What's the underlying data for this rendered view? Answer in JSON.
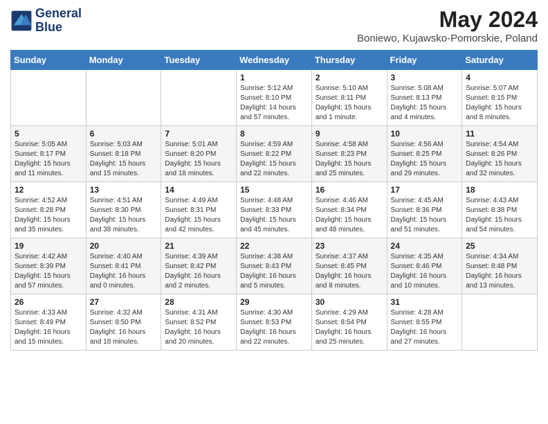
{
  "logo": {
    "line1": "General",
    "line2": "Blue"
  },
  "title": "May 2024",
  "subtitle": "Boniewo, Kujawsko-Pomorskie, Poland",
  "headers": [
    "Sunday",
    "Monday",
    "Tuesday",
    "Wednesday",
    "Thursday",
    "Friday",
    "Saturday"
  ],
  "weeks": [
    [
      {
        "day": "",
        "info": ""
      },
      {
        "day": "",
        "info": ""
      },
      {
        "day": "",
        "info": ""
      },
      {
        "day": "1",
        "info": "Sunrise: 5:12 AM\nSunset: 8:10 PM\nDaylight: 14 hours\nand 57 minutes."
      },
      {
        "day": "2",
        "info": "Sunrise: 5:10 AM\nSunset: 8:11 PM\nDaylight: 15 hours\nand 1 minute."
      },
      {
        "day": "3",
        "info": "Sunrise: 5:08 AM\nSunset: 8:13 PM\nDaylight: 15 hours\nand 4 minutes."
      },
      {
        "day": "4",
        "info": "Sunrise: 5:07 AM\nSunset: 8:15 PM\nDaylight: 15 hours\nand 8 minutes."
      }
    ],
    [
      {
        "day": "5",
        "info": "Sunrise: 5:05 AM\nSunset: 8:17 PM\nDaylight: 15 hours\nand 11 minutes."
      },
      {
        "day": "6",
        "info": "Sunrise: 5:03 AM\nSunset: 8:18 PM\nDaylight: 15 hours\nand 15 minutes."
      },
      {
        "day": "7",
        "info": "Sunrise: 5:01 AM\nSunset: 8:20 PM\nDaylight: 15 hours\nand 18 minutes."
      },
      {
        "day": "8",
        "info": "Sunrise: 4:59 AM\nSunset: 8:22 PM\nDaylight: 15 hours\nand 22 minutes."
      },
      {
        "day": "9",
        "info": "Sunrise: 4:58 AM\nSunset: 8:23 PM\nDaylight: 15 hours\nand 25 minutes."
      },
      {
        "day": "10",
        "info": "Sunrise: 4:56 AM\nSunset: 8:25 PM\nDaylight: 15 hours\nand 29 minutes."
      },
      {
        "day": "11",
        "info": "Sunrise: 4:54 AM\nSunset: 8:26 PM\nDaylight: 15 hours\nand 32 minutes."
      }
    ],
    [
      {
        "day": "12",
        "info": "Sunrise: 4:52 AM\nSunset: 8:28 PM\nDaylight: 15 hours\nand 35 minutes."
      },
      {
        "day": "13",
        "info": "Sunrise: 4:51 AM\nSunset: 8:30 PM\nDaylight: 15 hours\nand 38 minutes."
      },
      {
        "day": "14",
        "info": "Sunrise: 4:49 AM\nSunset: 8:31 PM\nDaylight: 15 hours\nand 42 minutes."
      },
      {
        "day": "15",
        "info": "Sunrise: 4:48 AM\nSunset: 8:33 PM\nDaylight: 15 hours\nand 45 minutes."
      },
      {
        "day": "16",
        "info": "Sunrise: 4:46 AM\nSunset: 8:34 PM\nDaylight: 15 hours\nand 48 minutes."
      },
      {
        "day": "17",
        "info": "Sunrise: 4:45 AM\nSunset: 8:36 PM\nDaylight: 15 hours\nand 51 minutes."
      },
      {
        "day": "18",
        "info": "Sunrise: 4:43 AM\nSunset: 8:38 PM\nDaylight: 15 hours\nand 54 minutes."
      }
    ],
    [
      {
        "day": "19",
        "info": "Sunrise: 4:42 AM\nSunset: 8:39 PM\nDaylight: 15 hours\nand 57 minutes."
      },
      {
        "day": "20",
        "info": "Sunrise: 4:40 AM\nSunset: 8:41 PM\nDaylight: 16 hours\nand 0 minutes."
      },
      {
        "day": "21",
        "info": "Sunrise: 4:39 AM\nSunset: 8:42 PM\nDaylight: 16 hours\nand 2 minutes."
      },
      {
        "day": "22",
        "info": "Sunrise: 4:38 AM\nSunset: 8:43 PM\nDaylight: 16 hours\nand 5 minutes."
      },
      {
        "day": "23",
        "info": "Sunrise: 4:37 AM\nSunset: 8:45 PM\nDaylight: 16 hours\nand 8 minutes."
      },
      {
        "day": "24",
        "info": "Sunrise: 4:35 AM\nSunset: 8:46 PM\nDaylight: 16 hours\nand 10 minutes."
      },
      {
        "day": "25",
        "info": "Sunrise: 4:34 AM\nSunset: 8:48 PM\nDaylight: 16 hours\nand 13 minutes."
      }
    ],
    [
      {
        "day": "26",
        "info": "Sunrise: 4:33 AM\nSunset: 8:49 PM\nDaylight: 16 hours\nand 15 minutes."
      },
      {
        "day": "27",
        "info": "Sunrise: 4:32 AM\nSunset: 8:50 PM\nDaylight: 16 hours\nand 18 minutes."
      },
      {
        "day": "28",
        "info": "Sunrise: 4:31 AM\nSunset: 8:52 PM\nDaylight: 16 hours\nand 20 minutes."
      },
      {
        "day": "29",
        "info": "Sunrise: 4:30 AM\nSunset: 8:53 PM\nDaylight: 16 hours\nand 22 minutes."
      },
      {
        "day": "30",
        "info": "Sunrise: 4:29 AM\nSunset: 8:54 PM\nDaylight: 16 hours\nand 25 minutes."
      },
      {
        "day": "31",
        "info": "Sunrise: 4:28 AM\nSunset: 8:55 PM\nDaylight: 16 hours\nand 27 minutes."
      },
      {
        "day": "",
        "info": ""
      }
    ]
  ]
}
